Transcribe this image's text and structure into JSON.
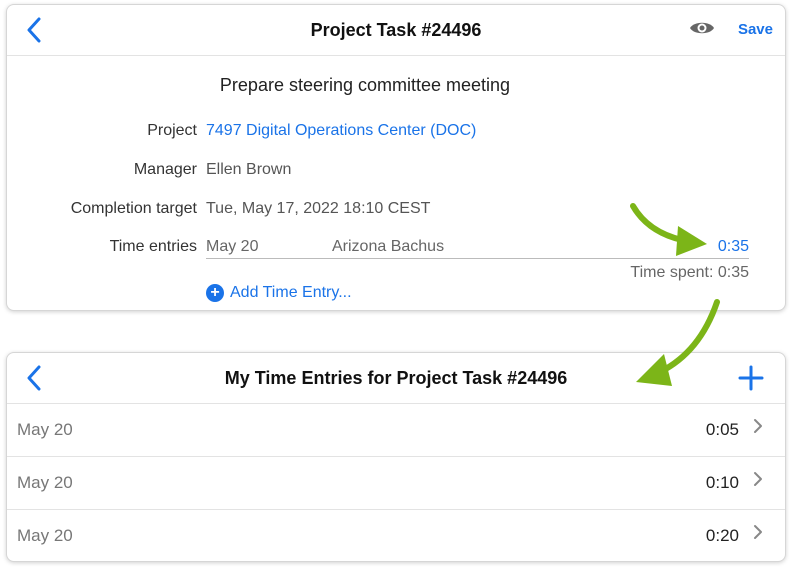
{
  "task_card": {
    "title": "Project Task #24496",
    "save_label": "Save",
    "task_name": "Prepare steering committee meeting",
    "fields": {
      "project_label": "Project",
      "project_value": "7497  Digital Operations Center (DOC)",
      "manager_label": "Manager",
      "manager_value": "Ellen Brown",
      "completion_label": "Completion target",
      "completion_value": "Tue, May 17, 2022 18:10 CEST",
      "time_entries_label": "Time entries"
    },
    "time_entry": {
      "date": "May 20",
      "person": "Arizona Bachus",
      "duration": "0:35"
    },
    "time_spent": "Time spent: 0:35",
    "add_entry_label": "Add Time Entry..."
  },
  "entries_card": {
    "title": "My Time Entries for Project Task #24496",
    "rows": [
      {
        "date": "May 20",
        "duration": "0:05"
      },
      {
        "date": "May 20",
        "duration": "0:10"
      },
      {
        "date": "May 20",
        "duration": "0:20"
      }
    ]
  },
  "colors": {
    "accent": "#1a73e8",
    "arrow": "#7cb518"
  },
  "icons": {
    "back": "chevron-left-icon",
    "view": "eye-icon",
    "add": "plus-icon",
    "add_circle": "plus-circle-icon",
    "row": "chevron-right-icon"
  }
}
